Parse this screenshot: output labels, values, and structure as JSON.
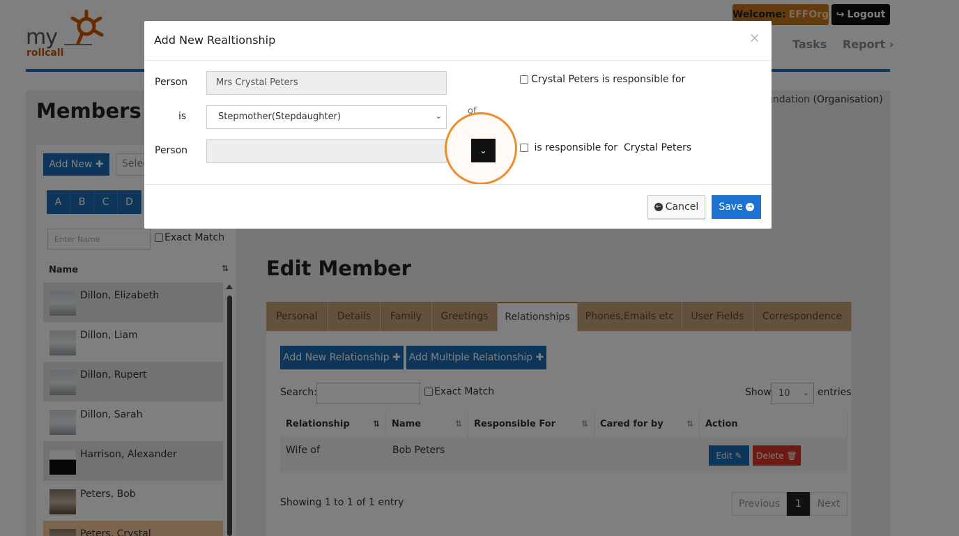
{
  "header": {
    "logo_my": "my",
    "logo_rollcall": "rollcall",
    "welcome_label": "Welcome:",
    "welcome_org": "EFFOrg",
    "logout_label": "Logout",
    "nav_tasks": "Tasks",
    "nav_report": "Report ›"
  },
  "page": {
    "members_title": "Members : ",
    "org_name": "undation",
    "org_type": "(Organisation)",
    "edit_member_title": "Edit Member"
  },
  "left_panel": {
    "add_new_label": "Add New ✚",
    "select_label": "Selec",
    "alphabet": [
      "A",
      "B",
      "C",
      "D"
    ],
    "name_placeholder": "Enter Name",
    "exact_match_label": "Exact Match",
    "name_column": "Name",
    "members": [
      "Dillon, Elizabeth",
      "Dillon, Liam",
      "Dillon, Rupert",
      "Dillon, Sarah",
      "Harrison, Alexander",
      "Peters, Bob",
      "Peters, Crystal"
    ]
  },
  "tabs": [
    "Personal",
    "Details",
    "Family",
    "Greetings",
    "Relationships",
    "Phones,Emails etc",
    "User Fields",
    "Correspondence"
  ],
  "active_tab": "Relationships",
  "relationships": {
    "add_new_label": "Add New Relationship ✚",
    "add_multiple_label": "Add Multiple Relationship ✚",
    "search_label": "Search:",
    "exact_match_label": "Exact Match",
    "show_label": "Show",
    "show_value": "10",
    "entries_label": "entries",
    "columns": [
      "Relationship",
      "Name",
      "Responsible For",
      "Cared for by",
      "Action"
    ],
    "rows": [
      {
        "relationship": "Wife of",
        "name": "Bob Peters",
        "responsible_for": "",
        "cared_for_by": ""
      }
    ],
    "edit_label": "Edit ✎",
    "delete_label": "Delete 🗑",
    "showing_text": "Showing 1 to 1 of 1 entry",
    "prev_label": "Previous",
    "page_number": "1",
    "next_label": "Next"
  },
  "modal": {
    "title": "Add New Realtionship",
    "close_glyph": "×",
    "person_label": "Person",
    "person_value": "Mrs Crystal  Peters",
    "is_label": "is",
    "relationship_value": "Stepmother(Stepdaughter)",
    "of_label": "of",
    "person2_label": "Person",
    "person2_value": "",
    "responsible_for_text": "Crystal Peters is responsible for",
    "responsible_by_text": " is responsible for  Crystal Peters",
    "cancel_label": "Cancel",
    "save_label": "Save"
  },
  "colors": {
    "primary_blue": "#1a6db5",
    "orange_accent": "#c8741e",
    "highlight_ring": "#ef8c2c",
    "tab_bar": "#c9a27a",
    "delete_red": "#d9342b"
  }
}
